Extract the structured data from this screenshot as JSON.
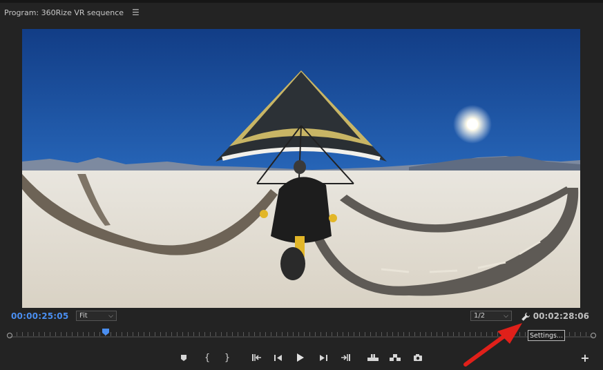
{
  "panel": {
    "title": "Program: 360Rize VR sequence",
    "menu_icon": "hamburger-menu-icon"
  },
  "monitor": {
    "current_timecode": "00:00:25:05",
    "duration_timecode": "00:02:28:06",
    "zoom_level": "Fit",
    "playback_resolution": "1/2",
    "playhead_position_fraction": 0.165
  },
  "settings": {
    "icon": "wrench-icon",
    "tooltip": "Settings..."
  },
  "transport": {
    "buttons": [
      {
        "name": "add-marker-button",
        "icon": "marker-icon"
      },
      {
        "name": "mark-in-button",
        "icon": "mark-in-icon"
      },
      {
        "name": "mark-out-button",
        "icon": "mark-out-icon"
      },
      {
        "name": "go-to-in-button",
        "icon": "go-to-in-icon"
      },
      {
        "name": "step-back-button",
        "icon": "step-back-icon"
      },
      {
        "name": "play-button",
        "icon": "play-icon"
      },
      {
        "name": "step-forward-button",
        "icon": "step-forward-icon"
      },
      {
        "name": "go-to-out-button",
        "icon": "go-to-out-icon"
      },
      {
        "name": "lift-button",
        "icon": "lift-icon"
      },
      {
        "name": "extract-button",
        "icon": "extract-icon"
      },
      {
        "name": "export-frame-button",
        "icon": "camera-icon"
      },
      {
        "name": "button-editor-button",
        "icon": "plus-icon"
      }
    ]
  },
  "colors": {
    "timecode_active": "#4a8ef0",
    "annotation_arrow": "#e0201a",
    "panel_background": "#232323"
  }
}
